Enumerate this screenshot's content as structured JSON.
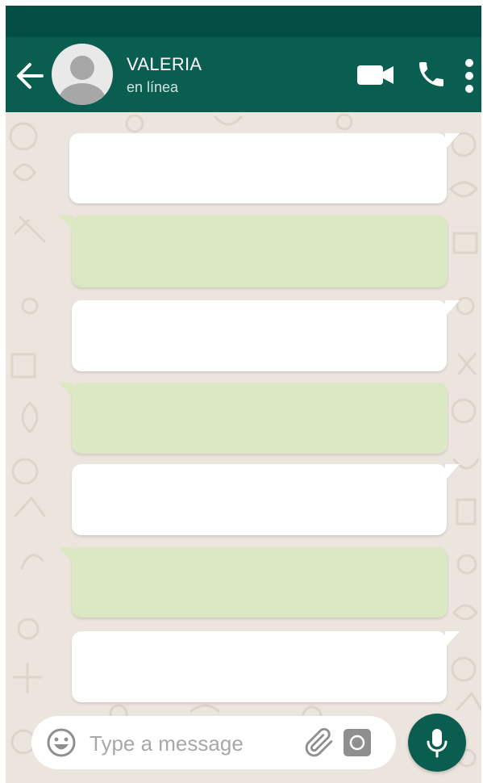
{
  "theme": {
    "status_bar": "#044d42",
    "header": "#0a5e50",
    "wallpaper": "#ece5dd",
    "incoming_bubble": "#ffffff",
    "outgoing_bubble": "#dbe8c3",
    "mic_button": "#0a5e50"
  },
  "header": {
    "back_icon": "arrow-left",
    "contact_name": "VALERIA",
    "contact_status": "en línea",
    "actions": [
      "video-camera",
      "phone-handset",
      "dots-vertical"
    ]
  },
  "messages": [
    {
      "direction": "incoming",
      "text": ""
    },
    {
      "direction": "outgoing",
      "text": ""
    },
    {
      "direction": "incoming",
      "text": ""
    },
    {
      "direction": "outgoing",
      "text": ""
    },
    {
      "direction": "incoming",
      "text": ""
    },
    {
      "direction": "outgoing",
      "text": ""
    },
    {
      "direction": "incoming",
      "text": ""
    }
  ],
  "composer": {
    "placeholder": "Type a message",
    "value": "",
    "emoji_icon": "smiley-face",
    "attach_icon": "paperclip",
    "camera_icon": "camera",
    "send_icon": "microphone"
  }
}
